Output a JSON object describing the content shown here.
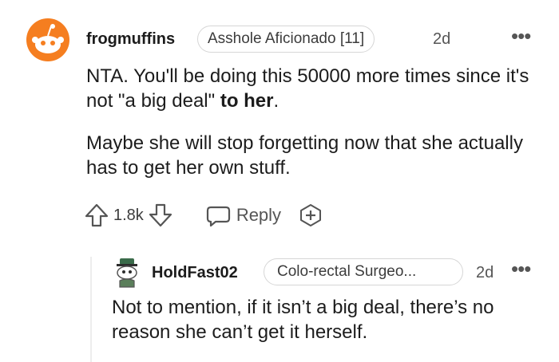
{
  "comment": {
    "username": "frogmuffins",
    "flair": "Asshole Aficionado [11]",
    "time": "2d",
    "more": "•••",
    "body_p1_before": "NTA. You'll be doing this 50000 more times since it's not \"a big deal\" ",
    "body_p1_bold": "to her",
    "body_p1_after": ".",
    "body_p2": "Maybe she will stop forgetting now that she actually has to get her own stuff.",
    "score": "1.8k",
    "reply_label": "Reply",
    "icons": {
      "avatar": "snoo-avatar-orange",
      "upvote": "upvote-arrow-icon",
      "downvote": "downvote-arrow-icon",
      "reply": "chat-bubble-icon",
      "award": "award-plus-icon",
      "more": "more-dots-icon"
    },
    "colors": {
      "avatar_bg": "#f57e20",
      "text": "#1c1c1c",
      "muted": "#555555"
    }
  },
  "reply": {
    "username": "HoldFast02",
    "flair": "Colo-rectal Surgeo...",
    "time": "2d",
    "more": "•••",
    "body": "Not to mention, if it isn’t a big deal, there’s no reason she can’t get it herself.",
    "icons": {
      "avatar": "snoo-avatar-hat",
      "more": "more-dots-icon"
    }
  }
}
